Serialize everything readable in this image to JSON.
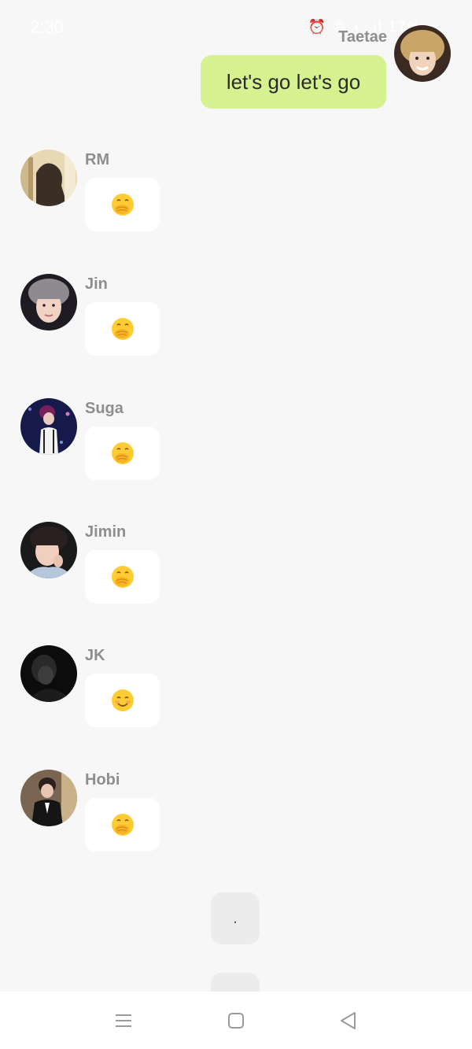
{
  "status_bar": {
    "time": "2:30",
    "icons": "⏰ ✆ ◖ .ıl 17% ▭"
  },
  "sent": {
    "name": "Taetae",
    "text": "let's go let's go"
  },
  "messages": [
    {
      "sender": "RM",
      "emoji": "hand-over-mouth"
    },
    {
      "sender": "Jin",
      "emoji": "hand-over-mouth"
    },
    {
      "sender": "Suga",
      "emoji": "hand-over-mouth"
    },
    {
      "sender": "Jimin",
      "emoji": "hand-over-mouth"
    },
    {
      "sender": "JK",
      "emoji": "smiling-face"
    },
    {
      "sender": "Hobi",
      "emoji": "hand-over-mouth"
    }
  ],
  "typing": {
    "text": "."
  },
  "colors": {
    "sent_bubble": "#d6f18f",
    "received_bubble": "#ffffff",
    "background": "#f7f7f7",
    "name_text": "#8e8e8e"
  },
  "nav": {
    "menu_icon": "menu-icon",
    "home_icon": "home-square-icon",
    "back_icon": "back-triangle-icon"
  }
}
